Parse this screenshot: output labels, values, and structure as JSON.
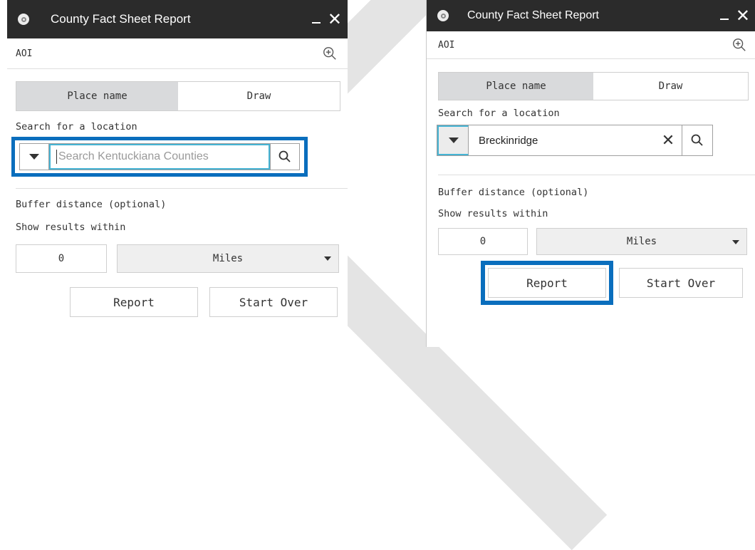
{
  "left_panel": {
    "title": "County Fact Sheet Report",
    "aoi_label": "AOI",
    "tabs": [
      {
        "label": "Place name",
        "active": true
      },
      {
        "label": "Draw",
        "active": false
      }
    ],
    "search_label": "Search for a location",
    "search_placeholder": "Search Kentuckiana Counties",
    "buffer_label": "Buffer distance (optional)",
    "within_label": "Show results within",
    "distance_value": "0",
    "units_value": "Miles",
    "report_label": "Report",
    "start_over_label": "Start Over"
  },
  "right_panel": {
    "title": "County Fact Sheet Report",
    "aoi_label": "AOI",
    "tabs": [
      {
        "label": "Place name",
        "active": true
      },
      {
        "label": "Draw",
        "active": false
      }
    ],
    "search_label": "Search for a location",
    "search_value": "Breckinridge",
    "buffer_label": "Buffer distance (optional)",
    "within_label": "Show results within",
    "distance_value": "0",
    "units_value": "Miles",
    "report_label": "Report",
    "start_over_label": "Start Over"
  },
  "colors": {
    "titlebar": "#2b2b2b",
    "highlight": "#0a6ebd",
    "focus": "#46b4d4",
    "active_tab": "#d9dadc"
  },
  "icons": [
    "app-icon",
    "minimize-icon",
    "close-icon",
    "zoom-in-icon",
    "dropdown-arrow-icon",
    "search-icon",
    "clear-icon"
  ]
}
